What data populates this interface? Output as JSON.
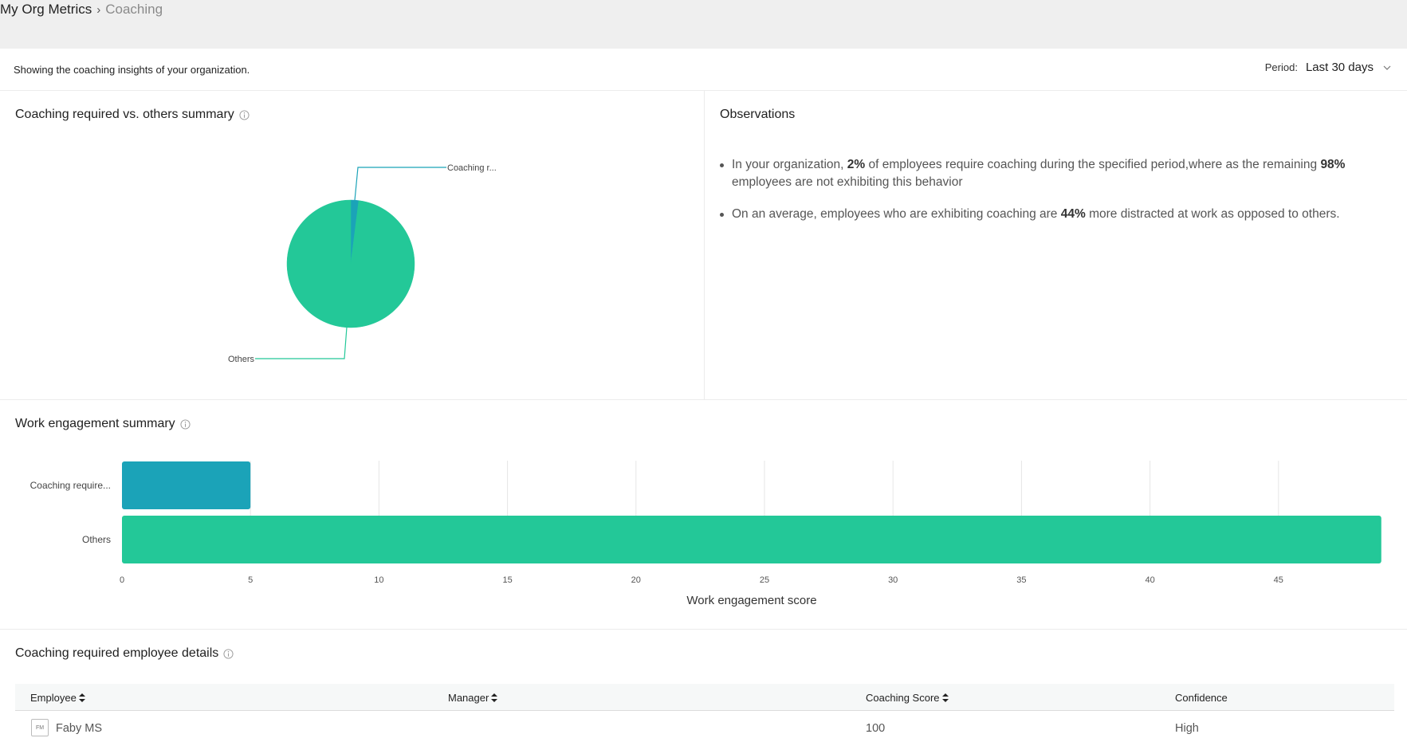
{
  "breadcrumb": {
    "root": "My Org Metrics",
    "separator": "›",
    "current": "Coaching"
  },
  "header": {
    "subtitle": "Showing the coaching insights of your organization.",
    "period_label": "Period:",
    "period_value": "Last 30 days"
  },
  "pie_panel": {
    "title": "Coaching required vs. others summary"
  },
  "observations": {
    "title": "Observations",
    "items": [
      {
        "pre": "In your organization, ",
        "b1": "2%",
        "mid": " of employees require coaching during the specified period,where as the remaining ",
        "b2": "98%",
        "post": " employees are not exhibiting this behavior"
      },
      {
        "pre": "On an average, employees who are exhibiting coaching are ",
        "b1": "44%",
        "post": " more distracted at work as opposed to others."
      }
    ]
  },
  "engagement_panel": {
    "title": "Work engagement summary"
  },
  "table": {
    "title": "Coaching required employee details",
    "headers": [
      "Employee",
      "Manager",
      "Coaching Score",
      "Confidence"
    ],
    "rows": [
      {
        "initials": "FM",
        "employee": "Faby MS",
        "manager": "",
        "score": "100",
        "confidence": "High"
      }
    ]
  },
  "colors": {
    "teal": "#1ba3b8",
    "green": "#23c898",
    "grid": "#e6e6e6"
  },
  "chart_data": [
    {
      "type": "pie",
      "title": "Coaching required vs. others summary",
      "labels": [
        "Coaching r...",
        "Others"
      ],
      "values": [
        2,
        98
      ],
      "colors": [
        "#1ba3b8",
        "#23c898"
      ]
    },
    {
      "type": "bar",
      "orientation": "horizontal",
      "title": "Work engagement summary",
      "categories": [
        "Coaching require...",
        "Others"
      ],
      "values": [
        5,
        49
      ],
      "colors": [
        "#1ba3b8",
        "#23c898"
      ],
      "xlabel": "Work engagement score",
      "xlim": [
        0,
        49
      ],
      "ticks": [
        "0",
        "5",
        "10",
        "15",
        "20",
        "25",
        "30",
        "35",
        "40",
        "45"
      ],
      "grid": true
    }
  ]
}
